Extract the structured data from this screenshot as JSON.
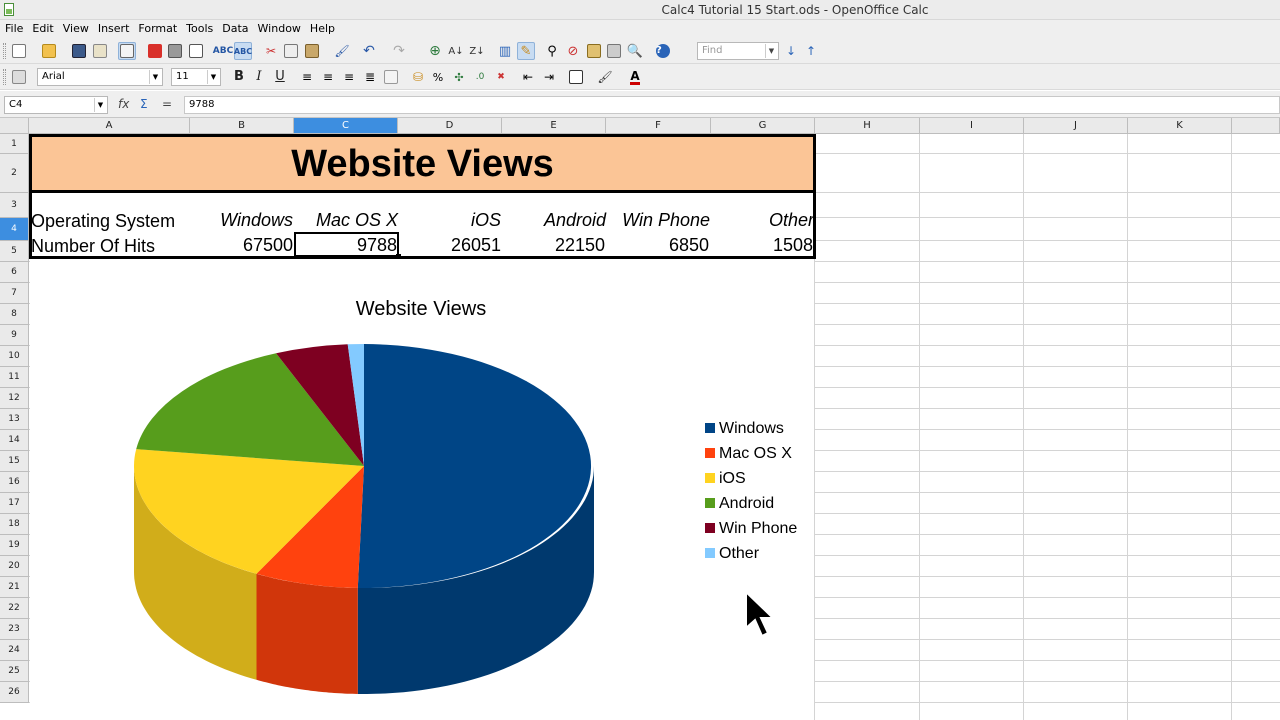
{
  "window": {
    "title": "Calc4 Tutorial 15 Start.ods - OpenOffice Calc"
  },
  "menu": [
    "File",
    "Edit",
    "View",
    "Insert",
    "Format",
    "Tools",
    "Data",
    "Window",
    "Help"
  ],
  "toolbar": {
    "find_placeholder": "Find"
  },
  "formatting": {
    "font_name": "Arial",
    "font_size": "11",
    "bold": "B",
    "italic": "I",
    "underline": "U"
  },
  "formula_bar": {
    "cell_ref": "C4",
    "formula": "9788",
    "equals": "="
  },
  "columns": [
    "A",
    "B",
    "C",
    "D",
    "E",
    "F",
    "G",
    "H",
    "I",
    "J",
    "K"
  ],
  "selected_column": "C",
  "rows": [
    "1",
    "2",
    "3",
    "4",
    "5",
    "6",
    "7",
    "8",
    "9",
    "10",
    "11",
    "12",
    "13",
    "14",
    "15",
    "16",
    "17",
    "18",
    "19",
    "20",
    "21",
    "22",
    "23",
    "24",
    "25",
    "26"
  ],
  "selected_row": "4",
  "sheet": {
    "title": "Website Views",
    "row_label_header": "Operating System",
    "row_label_values": "Number Of Hits",
    "categories": [
      "Windows",
      "Mac OS X",
      "iOS",
      "Android",
      "Win Phone",
      "Other"
    ],
    "values": [
      "67500",
      "9788",
      "26051",
      "22150",
      "6850",
      "1508"
    ]
  },
  "chart_data": {
    "type": "pie",
    "title": "Website Views",
    "categories": [
      "Windows",
      "Mac OS X",
      "iOS",
      "Android",
      "Win Phone",
      "Other"
    ],
    "values": [
      67500,
      9788,
      26051,
      22150,
      6850,
      1508
    ],
    "colors": [
      "#004586",
      "#ff420e",
      "#ffd320",
      "#579d1c",
      "#7e0021",
      "#83caff"
    ],
    "style": "3d",
    "legend": "right"
  }
}
